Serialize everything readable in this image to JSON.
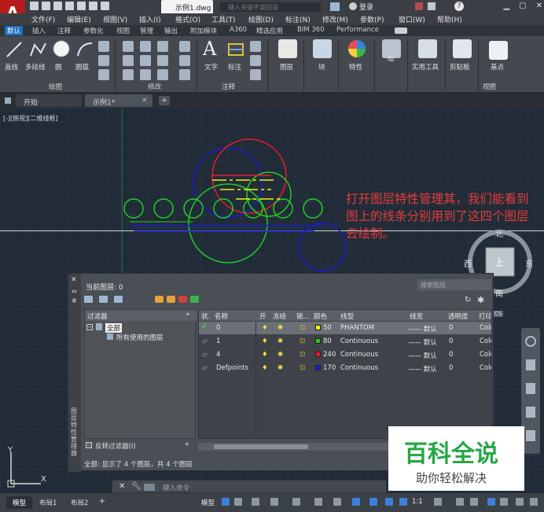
{
  "window": {
    "logo": "A",
    "file_name": "示例1.dwg",
    "search_placeholder": "键入关键字或短语",
    "sign_in": "登录",
    "help": "?"
  },
  "menu": [
    "文件(F)",
    "编辑(E)",
    "视图(V)",
    "插入(I)",
    "格式(O)",
    "工具(T)",
    "绘图(D)",
    "标注(N)",
    "修改(M)",
    "参数(P)",
    "窗口(W)",
    "帮助(H)"
  ],
  "ribbon_tabs": [
    "默认",
    "插入",
    "注释",
    "参数化",
    "视图",
    "管理",
    "输出",
    "附加模块",
    "A360",
    "精选应用",
    "BIM 360",
    "Performance"
  ],
  "ribbon": {
    "draw": {
      "line": "直线",
      "polyline": "多段线",
      "circle": "圆",
      "arc": "圆弧",
      "panel": "绘图"
    },
    "modify": {
      "panel": "修改"
    },
    "annotation": {
      "text": "文字",
      "dimension": "标注",
      "panel": "注释"
    },
    "layers": {
      "label": "图层"
    },
    "block": {
      "label": "块"
    },
    "properties": {
      "label": "特性"
    },
    "groups": {
      "label": "组"
    },
    "utilities": {
      "label": "实用工具"
    },
    "clipboard": {
      "label": "剪贴板"
    },
    "base": {
      "label": "基点"
    },
    "view": {
      "panel": "视图"
    }
  },
  "doc_tabs": {
    "start": "开始",
    "current": "示例1*"
  },
  "viewport_label": "[-][俯视][二维线框]",
  "viewcube": {
    "north": "北",
    "south": "南",
    "east": "东",
    "west": "西",
    "top": "上",
    "wcs": "WCS"
  },
  "annotation_text": "打开图层特性管理其，我们能看到图上的线条分别用到了这四个图层去绘制。",
  "layer_manager": {
    "current_layer": "当前图层: 0",
    "search_placeholder": "搜索图层",
    "filter_header": "过滤器",
    "filter_all": "全部",
    "filter_used": "所有使用的图层",
    "invert_filter": "反转过滤器(I)",
    "status_text": "全部: 显示了 4 个图层，共 4 个图层",
    "side_title": "图层特性管理器",
    "columns": [
      "状.",
      "名称",
      "开",
      "冻结",
      "锁...",
      "颜色",
      "线型",
      "线宽",
      "透明度",
      "打印"
    ],
    "rows": [
      {
        "name": "0",
        "color_index": "50",
        "color": "#f2f20a",
        "linetype": "PHANTOM",
        "lineweight": "—— 默认",
        "transparency": "0",
        "plot": "Colo"
      },
      {
        "name": "1",
        "color_index": "80",
        "color": "#1fcf1f",
        "linetype": "Continuous",
        "lineweight": "—— 默认",
        "transparency": "0",
        "plot": "Colo"
      },
      {
        "name": "4",
        "color_index": "240",
        "color": "#e81a2f",
        "linetype": "Continuous",
        "lineweight": "—— 默认",
        "transparency": "0",
        "plot": "Colo"
      },
      {
        "name": "Defpoints",
        "color_index": "170",
        "color": "#1a1ad6",
        "linetype": "Continuous",
        "lineweight": "—— 默认",
        "transparency": "0",
        "plot": "Colo"
      }
    ]
  },
  "command": {
    "placeholder": "键入命令"
  },
  "layout_tabs": [
    "模型",
    "布局1",
    "布局2"
  ],
  "status_bar": {
    "model": "模型",
    "scale": "1:1"
  },
  "ucs": {
    "x": "X",
    "y": "Y"
  },
  "watermark": {
    "title": "百科全说",
    "subtitle": "助你轻松解决"
  },
  "colors": {
    "accent": "#1f6dbc",
    "circle_green": "#1fcf1f",
    "circle_blue": "#1a1ad6",
    "circle_red": "#e81a2f",
    "annotation_red": "#e83a3a"
  }
}
